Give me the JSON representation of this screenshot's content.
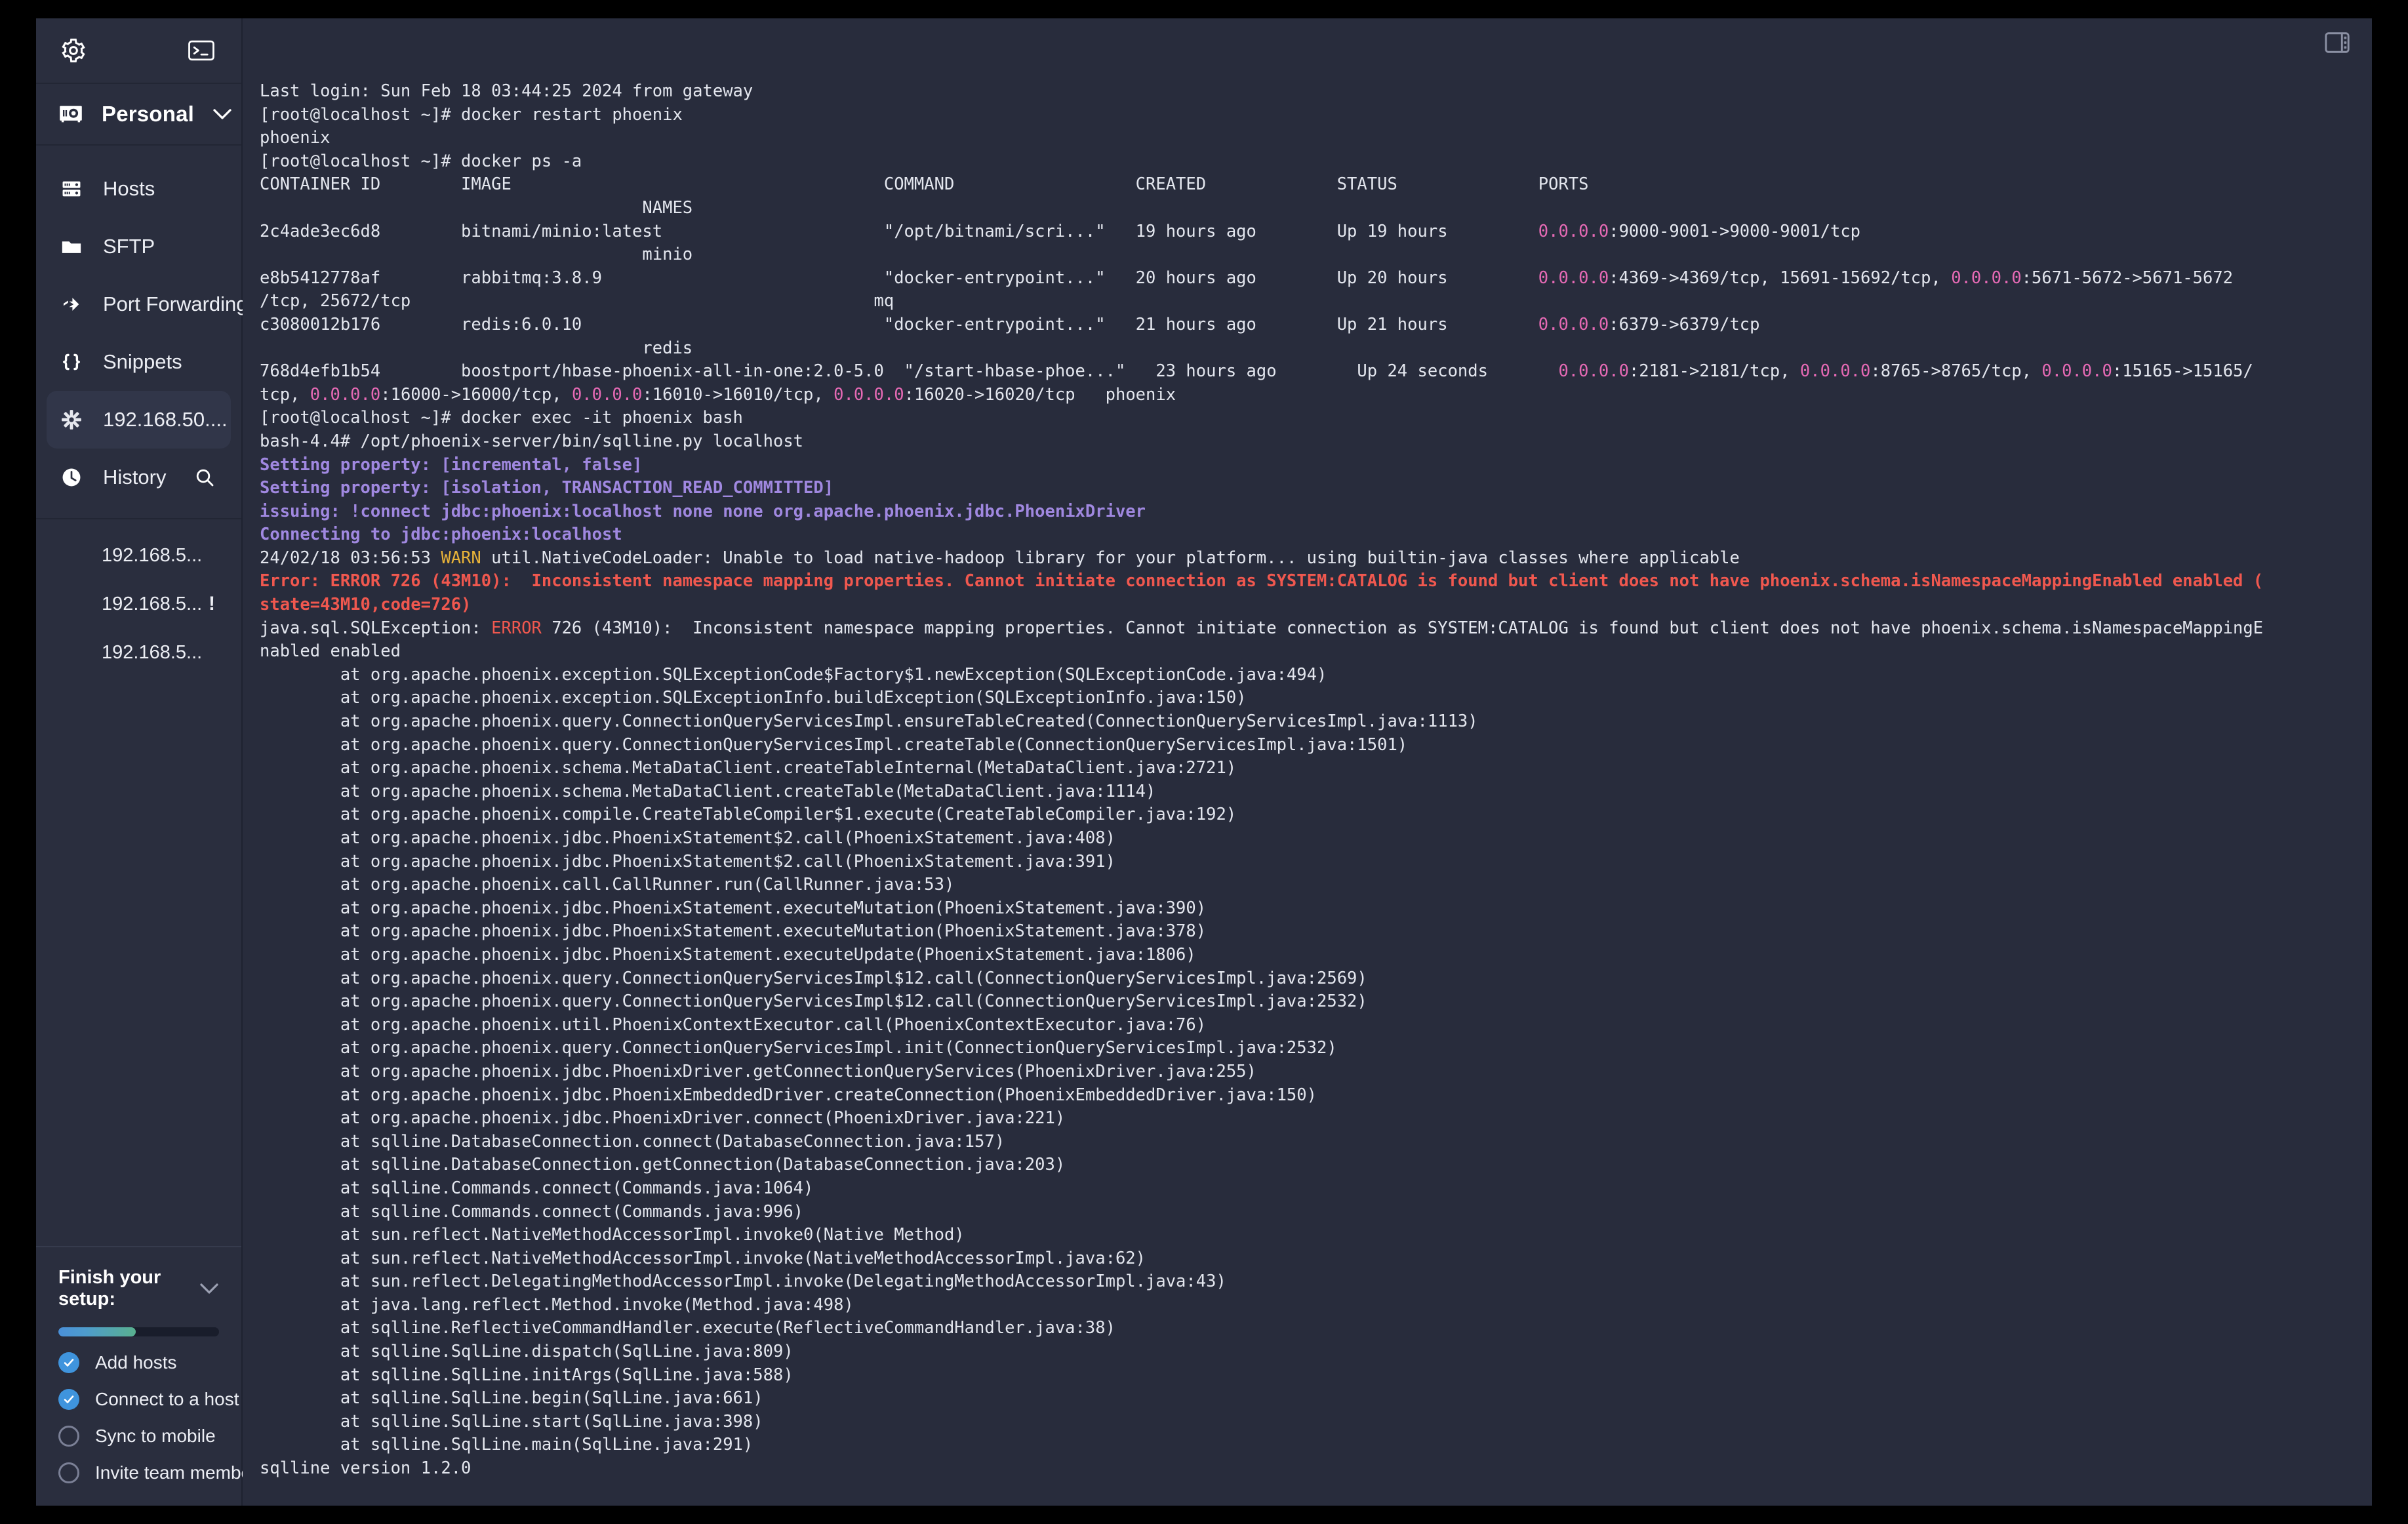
{
  "sidebar": {
    "top": {
      "settings_icon": "gear-icon",
      "terminal_icon": "terminal-icon"
    },
    "vault": {
      "label": "Personal",
      "icon": "vault-icon",
      "chevron": "chevron-down-icon"
    },
    "nav": [
      {
        "label": "Hosts",
        "icon": "server-icon",
        "active": false
      },
      {
        "label": "SFTP",
        "icon": "folder-icon",
        "active": false
      },
      {
        "label": "Port Forwarding",
        "icon": "arrows-right-icon",
        "active": false
      },
      {
        "label": "Snippets",
        "icon": "braces-icon",
        "active": false
      },
      {
        "label": "192.168.50....",
        "icon": "asterisk-icon",
        "active": true
      },
      {
        "label": "History",
        "icon": "clock-icon",
        "active": false,
        "trailing_icon": "search-icon"
      }
    ],
    "history": [
      {
        "label": "192.168.5...",
        "badge": ""
      },
      {
        "label": "192.168.5...",
        "badge": "!"
      },
      {
        "label": "192.168.5...",
        "badge": ""
      }
    ],
    "setup": {
      "title": "Finish your setup:",
      "chevron": "chevron-down-icon",
      "progress_percent": 48,
      "tasks": [
        {
          "label": "Add hosts",
          "done": true
        },
        {
          "label": "Connect to a host",
          "done": true
        },
        {
          "label": "Sync to mobile",
          "done": false
        },
        {
          "label": "Invite team members",
          "done": false
        }
      ]
    }
  },
  "terminal": {
    "layout_icon": "split-panel-icon",
    "lines": [
      {
        "segments": [
          {
            "t": "Last login: Sun Feb 18 03:44:25 2024 from gateway",
            "c": "c-white"
          }
        ]
      },
      {
        "segments": [
          {
            "t": "[root@localhost ~]# docker restart phoenix",
            "c": "c-white"
          }
        ]
      },
      {
        "segments": [
          {
            "t": "phoenix",
            "c": "c-white"
          }
        ]
      },
      {
        "segments": [
          {
            "t": "[root@localhost ~]# docker ps -a",
            "c": "c-white"
          }
        ]
      },
      {
        "segments": [
          {
            "t": "CONTAINER ID        IMAGE                                     COMMAND                  CREATED             STATUS              PORTS",
            "c": "c-white"
          }
        ]
      },
      {
        "segments": [
          {
            "t": "                                      NAMES",
            "c": "c-white"
          }
        ]
      },
      {
        "segments": [
          {
            "t": "2c4ade3ec6d8        bitnami/minio:latest                      \"/opt/bitnami/scri...\"   19 hours ago        Up 19 hours         ",
            "c": "c-white"
          },
          {
            "t": "0.0.0.0",
            "c": "c-magenta"
          },
          {
            "t": ":9000-9001->9000-9001/tcp",
            "c": "c-white"
          }
        ]
      },
      {
        "segments": [
          {
            "t": "                                      minio",
            "c": "c-white"
          }
        ]
      },
      {
        "segments": [
          {
            "t": "e8b5412778af        rabbitmq:3.8.9                            \"docker-entrypoint...\"   20 hours ago        Up 20 hours         ",
            "c": "c-white"
          },
          {
            "t": "0.0.0.0",
            "c": "c-magenta"
          },
          {
            "t": ":4369->4369/tcp, 15691-15692/tcp, ",
            "c": "c-white"
          },
          {
            "t": "0.0.0.0",
            "c": "c-magenta"
          },
          {
            "t": ":5671-5672->5671-5672",
            "c": "c-white"
          }
        ]
      },
      {
        "segments": [
          {
            "t": "/tcp, 25672/tcp                                              mq",
            "c": "c-white"
          }
        ]
      },
      {
        "segments": [
          {
            "t": "c3080012b176        redis:6.0.10                              \"docker-entrypoint...\"   21 hours ago        Up 21 hours         ",
            "c": "c-white"
          },
          {
            "t": "0.0.0.0",
            "c": "c-magenta"
          },
          {
            "t": ":6379->6379/tcp",
            "c": "c-white"
          }
        ]
      },
      {
        "segments": [
          {
            "t": "                                      redis",
            "c": "c-white"
          }
        ]
      },
      {
        "segments": [
          {
            "t": "768d4efb1b54        boostport/hbase-phoenix-all-in-one:2.0-5.0  \"/start-hbase-phoe...\"   23 hours ago        Up 24 seconds       ",
            "c": "c-white"
          },
          {
            "t": "0.0.0.0",
            "c": "c-magenta"
          },
          {
            "t": ":2181->2181/tcp, ",
            "c": "c-white"
          },
          {
            "t": "0.0.0.0",
            "c": "c-magenta"
          },
          {
            "t": ":8765->8765/tcp, ",
            "c": "c-white"
          },
          {
            "t": "0.0.0.0",
            "c": "c-magenta"
          },
          {
            "t": ":15165->15165/",
            "c": "c-white"
          }
        ]
      },
      {
        "segments": [
          {
            "t": "tcp, ",
            "c": "c-white"
          },
          {
            "t": "0.0.0.0",
            "c": "c-magenta"
          },
          {
            "t": ":16000->16000/tcp, ",
            "c": "c-white"
          },
          {
            "t": "0.0.0.0",
            "c": "c-magenta"
          },
          {
            "t": ":16010->16010/tcp, ",
            "c": "c-white"
          },
          {
            "t": "0.0.0.0",
            "c": "c-magenta"
          },
          {
            "t": ":16020->16020/tcp   phoenix",
            "c": "c-white"
          }
        ]
      },
      {
        "segments": [
          {
            "t": "[root@localhost ~]# docker exec -it phoenix bash",
            "c": "c-white"
          }
        ]
      },
      {
        "segments": [
          {
            "t": "bash-4.4# /opt/phoenix-server/bin/sqlline.py localhost",
            "c": "c-white"
          }
        ]
      },
      {
        "segments": [
          {
            "t": "Setting property: [incremental, false]",
            "c": "c-purple"
          }
        ]
      },
      {
        "segments": [
          {
            "t": "Setting property: [isolation, TRANSACTION_READ_COMMITTED]",
            "c": "c-purple"
          }
        ]
      },
      {
        "segments": [
          {
            "t": "issuing: !connect jdbc:phoenix:localhost none none org.apache.phoenix.jdbc.PhoenixDriver",
            "c": "c-purple"
          }
        ]
      },
      {
        "segments": [
          {
            "t": "Connecting to jdbc:phoenix:localhost",
            "c": "c-purple"
          }
        ]
      },
      {
        "segments": [
          {
            "t": "24/02/18 03:56:53 ",
            "c": "c-white"
          },
          {
            "t": "WARN",
            "c": "c-yellow"
          },
          {
            "t": " util.NativeCodeLoader: Unable to load native-hadoop library for your platform... using builtin-java classes where applicable",
            "c": "c-white"
          }
        ]
      },
      {
        "segments": [
          {
            "t": "Error: ERROR 726 (43M10):  Inconsistent namespace mapping properties. Cannot initiate connection as SYSTEM:CATALOG is found but client does not have phoenix.schema.isNamespaceMappingEnabled enabled (",
            "c": "c-red"
          }
        ]
      },
      {
        "segments": [
          {
            "t": "state=43M10,code=726)",
            "c": "c-red"
          }
        ]
      },
      {
        "segments": [
          {
            "t": "java.sql.SQLException: ",
            "c": "c-white"
          },
          {
            "t": "ERROR",
            "c": "c-red2"
          },
          {
            "t": " 726 (43M10):  Inconsistent namespace mapping properties. Cannot initiate connection as SYSTEM:CATALOG is found but client does not have phoenix.schema.isNamespaceMappingE",
            "c": "c-white"
          }
        ]
      },
      {
        "segments": [
          {
            "t": "nabled enabled",
            "c": "c-white"
          }
        ]
      },
      {
        "segments": [
          {
            "t": "        at org.apache.phoenix.exception.SQLExceptionCode$Factory$1.newException(SQLExceptionCode.java:494)",
            "c": "c-white"
          }
        ]
      },
      {
        "segments": [
          {
            "t": "        at org.apache.phoenix.exception.SQLExceptionInfo.buildException(SQLExceptionInfo.java:150)",
            "c": "c-white"
          }
        ]
      },
      {
        "segments": [
          {
            "t": "        at org.apache.phoenix.query.ConnectionQueryServicesImpl.ensureTableCreated(ConnectionQueryServicesImpl.java:1113)",
            "c": "c-white"
          }
        ]
      },
      {
        "segments": [
          {
            "t": "        at org.apache.phoenix.query.ConnectionQueryServicesImpl.createTable(ConnectionQueryServicesImpl.java:1501)",
            "c": "c-white"
          }
        ]
      },
      {
        "segments": [
          {
            "t": "        at org.apache.phoenix.schema.MetaDataClient.createTableInternal(MetaDataClient.java:2721)",
            "c": "c-white"
          }
        ]
      },
      {
        "segments": [
          {
            "t": "        at org.apache.phoenix.schema.MetaDataClient.createTable(MetaDataClient.java:1114)",
            "c": "c-white"
          }
        ]
      },
      {
        "segments": [
          {
            "t": "        at org.apache.phoenix.compile.CreateTableCompiler$1.execute(CreateTableCompiler.java:192)",
            "c": "c-white"
          }
        ]
      },
      {
        "segments": [
          {
            "t": "        at org.apache.phoenix.jdbc.PhoenixStatement$2.call(PhoenixStatement.java:408)",
            "c": "c-white"
          }
        ]
      },
      {
        "segments": [
          {
            "t": "        at org.apache.phoenix.jdbc.PhoenixStatement$2.call(PhoenixStatement.java:391)",
            "c": "c-white"
          }
        ]
      },
      {
        "segments": [
          {
            "t": "        at org.apache.phoenix.call.CallRunner.run(CallRunner.java:53)",
            "c": "c-white"
          }
        ]
      },
      {
        "segments": [
          {
            "t": "        at org.apache.phoenix.jdbc.PhoenixStatement.executeMutation(PhoenixStatement.java:390)",
            "c": "c-white"
          }
        ]
      },
      {
        "segments": [
          {
            "t": "        at org.apache.phoenix.jdbc.PhoenixStatement.executeMutation(PhoenixStatement.java:378)",
            "c": "c-white"
          }
        ]
      },
      {
        "segments": [
          {
            "t": "        at org.apache.phoenix.jdbc.PhoenixStatement.executeUpdate(PhoenixStatement.java:1806)",
            "c": "c-white"
          }
        ]
      },
      {
        "segments": [
          {
            "t": "        at org.apache.phoenix.query.ConnectionQueryServicesImpl$12.call(ConnectionQueryServicesImpl.java:2569)",
            "c": "c-white"
          }
        ]
      },
      {
        "segments": [
          {
            "t": "        at org.apache.phoenix.query.ConnectionQueryServicesImpl$12.call(ConnectionQueryServicesImpl.java:2532)",
            "c": "c-white"
          }
        ]
      },
      {
        "segments": [
          {
            "t": "        at org.apache.phoenix.util.PhoenixContextExecutor.call(PhoenixContextExecutor.java:76)",
            "c": "c-white"
          }
        ]
      },
      {
        "segments": [
          {
            "t": "        at org.apache.phoenix.query.ConnectionQueryServicesImpl.init(ConnectionQueryServicesImpl.java:2532)",
            "c": "c-white"
          }
        ]
      },
      {
        "segments": [
          {
            "t": "        at org.apache.phoenix.jdbc.PhoenixDriver.getConnectionQueryServices(PhoenixDriver.java:255)",
            "c": "c-white"
          }
        ]
      },
      {
        "segments": [
          {
            "t": "        at org.apache.phoenix.jdbc.PhoenixEmbeddedDriver.createConnection(PhoenixEmbeddedDriver.java:150)",
            "c": "c-white"
          }
        ]
      },
      {
        "segments": [
          {
            "t": "        at org.apache.phoenix.jdbc.PhoenixDriver.connect(PhoenixDriver.java:221)",
            "c": "c-white"
          }
        ]
      },
      {
        "segments": [
          {
            "t": "        at sqlline.DatabaseConnection.connect(DatabaseConnection.java:157)",
            "c": "c-white"
          }
        ]
      },
      {
        "segments": [
          {
            "t": "        at sqlline.DatabaseConnection.getConnection(DatabaseConnection.java:203)",
            "c": "c-white"
          }
        ]
      },
      {
        "segments": [
          {
            "t": "        at sqlline.Commands.connect(Commands.java:1064)",
            "c": "c-white"
          }
        ]
      },
      {
        "segments": [
          {
            "t": "        at sqlline.Commands.connect(Commands.java:996)",
            "c": "c-white"
          }
        ]
      },
      {
        "segments": [
          {
            "t": "        at sun.reflect.NativeMethodAccessorImpl.invoke0(Native Method)",
            "c": "c-white"
          }
        ]
      },
      {
        "segments": [
          {
            "t": "        at sun.reflect.NativeMethodAccessorImpl.invoke(NativeMethodAccessorImpl.java:62)",
            "c": "c-white"
          }
        ]
      },
      {
        "segments": [
          {
            "t": "        at sun.reflect.DelegatingMethodAccessorImpl.invoke(DelegatingMethodAccessorImpl.java:43)",
            "c": "c-white"
          }
        ]
      },
      {
        "segments": [
          {
            "t": "        at java.lang.reflect.Method.invoke(Method.java:498)",
            "c": "c-white"
          }
        ]
      },
      {
        "segments": [
          {
            "t": "        at sqlline.ReflectiveCommandHandler.execute(ReflectiveCommandHandler.java:38)",
            "c": "c-white"
          }
        ]
      },
      {
        "segments": [
          {
            "t": "        at sqlline.SqlLine.dispatch(SqlLine.java:809)",
            "c": "c-white"
          }
        ]
      },
      {
        "segments": [
          {
            "t": "        at sqlline.SqlLine.initArgs(SqlLine.java:588)",
            "c": "c-white"
          }
        ]
      },
      {
        "segments": [
          {
            "t": "        at sqlline.SqlLine.begin(SqlLine.java:661)",
            "c": "c-white"
          }
        ]
      },
      {
        "segments": [
          {
            "t": "        at sqlline.SqlLine.start(SqlLine.java:398)",
            "c": "c-white"
          }
        ]
      },
      {
        "segments": [
          {
            "t": "        at sqlline.SqlLine.main(SqlLine.java:291)",
            "c": "c-white"
          }
        ]
      },
      {
        "segments": [
          {
            "t": "sqlline version 1.2.0",
            "c": "c-white"
          }
        ]
      }
    ]
  },
  "colors": {
    "app_bg": "#282c3c",
    "sidebar_bg": "#2a2e3e",
    "accent_blue": "#3f94dd",
    "accent_green": "#59b08f",
    "magenta": "#e66ab5",
    "purple": "#a088e0",
    "red": "#f0584f",
    "yellow": "#e8b339"
  }
}
